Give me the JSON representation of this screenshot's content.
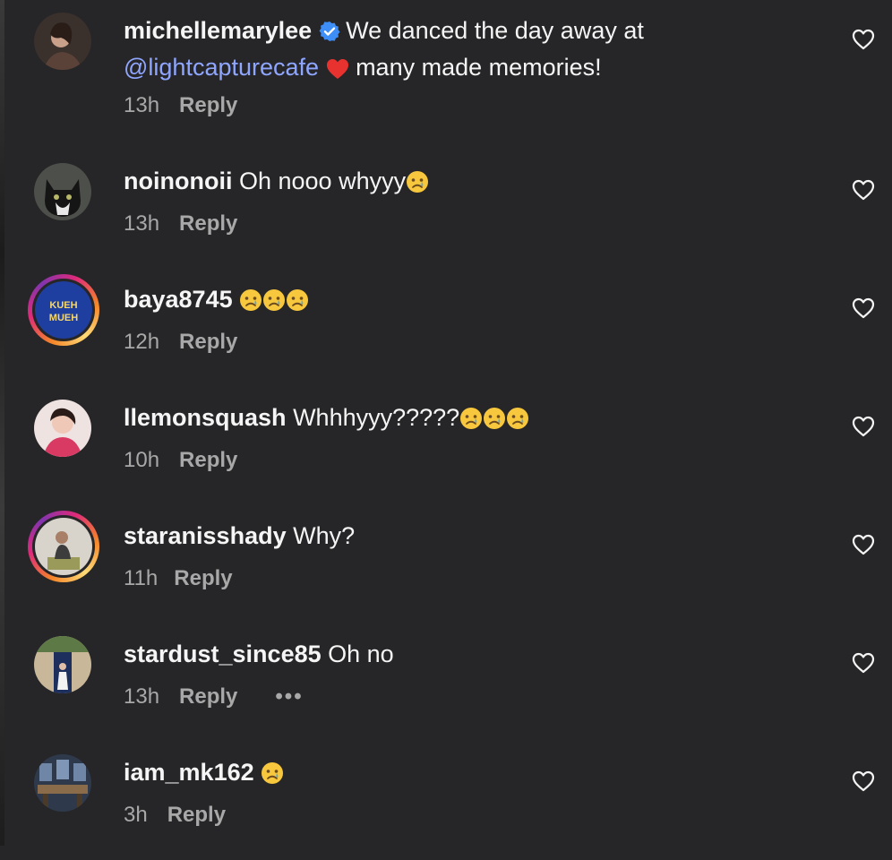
{
  "comments": [
    {
      "username": "michellemarylee",
      "verified": true,
      "text_part1": "We danced the day away at",
      "mention": "@lightcapturecafe",
      "text_part2": "many made memories!",
      "emoji_after_mention": "red-heart",
      "time": "13h",
      "reply_label": "Reply",
      "avatar": "woman-portrait"
    },
    {
      "username": "noinonoii",
      "text": "Oh nooo whyyy",
      "emoji": "crying-face",
      "time": "13h",
      "reply_label": "Reply",
      "avatar": "cat"
    },
    {
      "username": "baya8745",
      "emoji_count": 3,
      "emoji": "crying-face",
      "time": "12h",
      "reply_label": "Reply",
      "avatar_text_1": "KUEH",
      "avatar_text_2": "MUEH",
      "avatar_ring": true
    },
    {
      "username": "llemonsquash",
      "text": "Whhhyyy?????",
      "emoji_count": 3,
      "emoji": "crying-face",
      "time": "10h",
      "reply_label": "Reply",
      "avatar": "woman-pink"
    },
    {
      "username": "staranisshady",
      "text": "Why?",
      "time": "11h",
      "reply_label": "Reply",
      "avatar": "woman-frame",
      "avatar_ring": true
    },
    {
      "username": "stardust_since85",
      "text": "Oh no",
      "time": "13h",
      "reply_label": "Reply",
      "more_label": "•••",
      "avatar": "doorway"
    },
    {
      "username": "iam_mk162",
      "emoji": "crying-face",
      "time": "3h",
      "reply_label": "Reply",
      "avatar": "furniture"
    }
  ],
  "icons": {
    "like": "heart-outline-icon",
    "verified": "verified-badge-icon"
  },
  "colors": {
    "background": "#262628",
    "text": "#f5f5f5",
    "meta": "#a8a8a8",
    "mention": "#8fa6ff",
    "verified": "#3d8ef7"
  }
}
